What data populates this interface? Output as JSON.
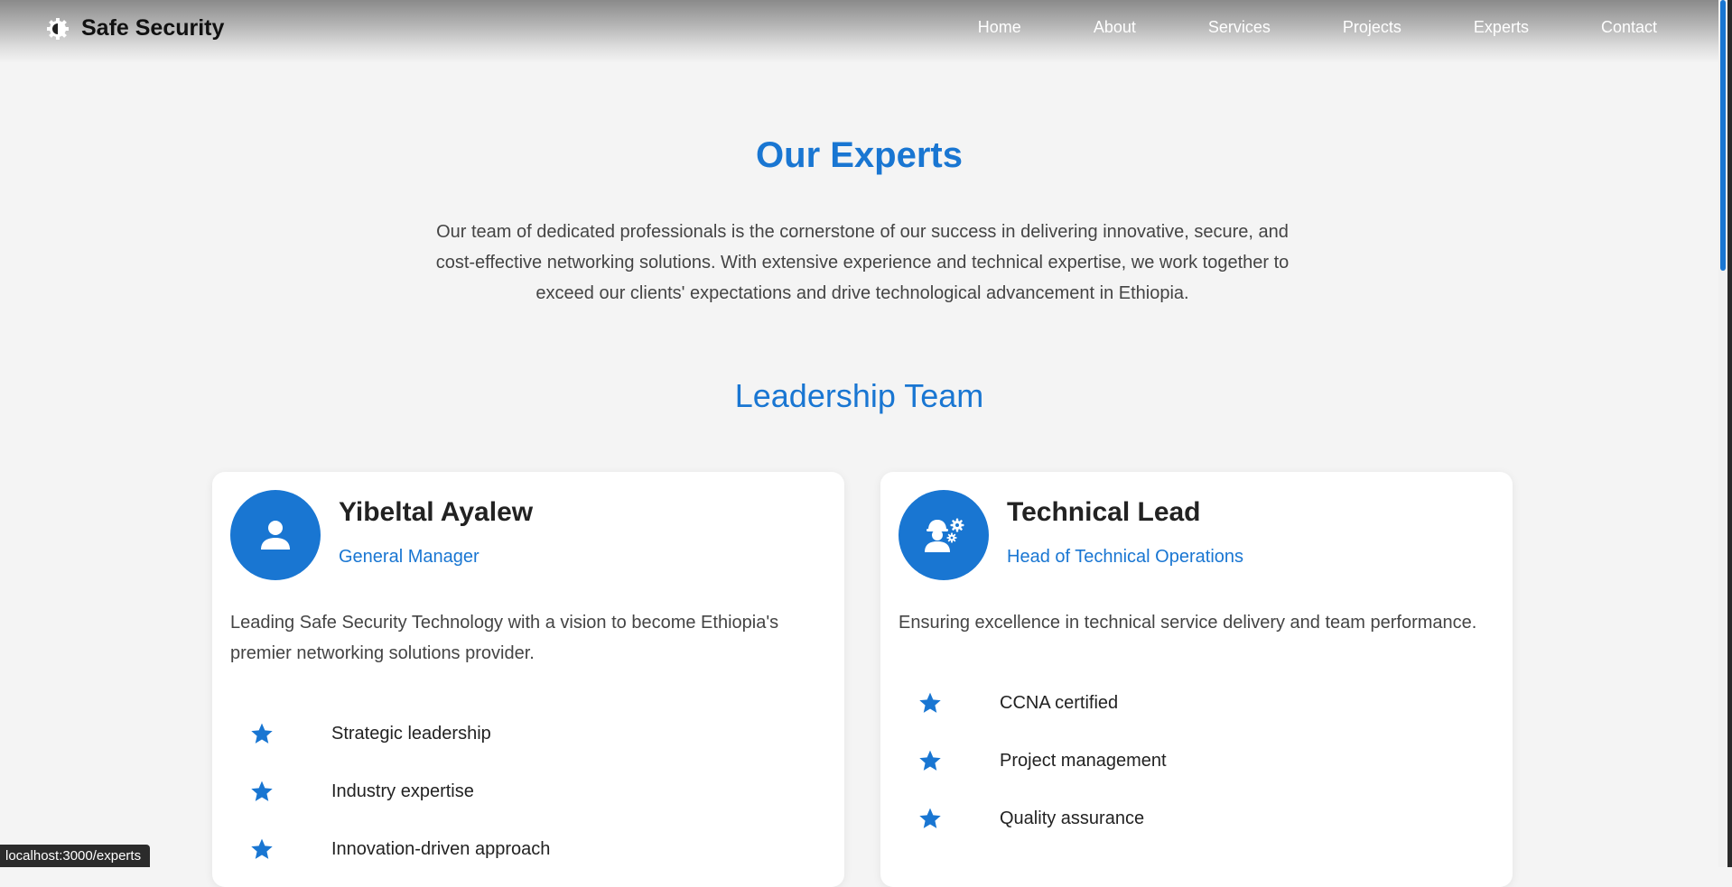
{
  "brand": {
    "name": "Safe Security"
  },
  "nav": {
    "items": [
      "Home",
      "About",
      "Services",
      "Projects",
      "Experts",
      "Contact"
    ]
  },
  "page": {
    "title": "Our Experts",
    "intro": "Our team of dedicated professionals is the cornerstone of our success in delivering innovative, secure, and cost-effective networking solutions. With extensive experience and technical expertise, we work together to exceed our clients' expectations and drive technological advancement in Ethiopia.",
    "section_title": "Leadership Team"
  },
  "experts": [
    {
      "name": "Yibeltal Ayalew",
      "role": "General Manager",
      "description": "Leading Safe Security Technology with a vision to become Ethiopia's premier networking solutions provider.",
      "avatar_icon": "person-icon",
      "skills": [
        "Strategic leadership",
        "Industry expertise",
        "Innovation-driven approach"
      ]
    },
    {
      "name": "Technical Lead",
      "role": "Head of Technical Operations",
      "description": "Ensuring excellence in technical service delivery and team performance.",
      "avatar_icon": "engineer-gears-icon",
      "skills": [
        "CCNA certified",
        "Project management",
        "Quality assurance"
      ]
    }
  ],
  "status_bar": {
    "url": "localhost:3000/experts"
  },
  "colors": {
    "accent": "#1976d2",
    "background": "#f4f4f4",
    "card": "#ffffff",
    "nav_link": "#ffffff"
  }
}
